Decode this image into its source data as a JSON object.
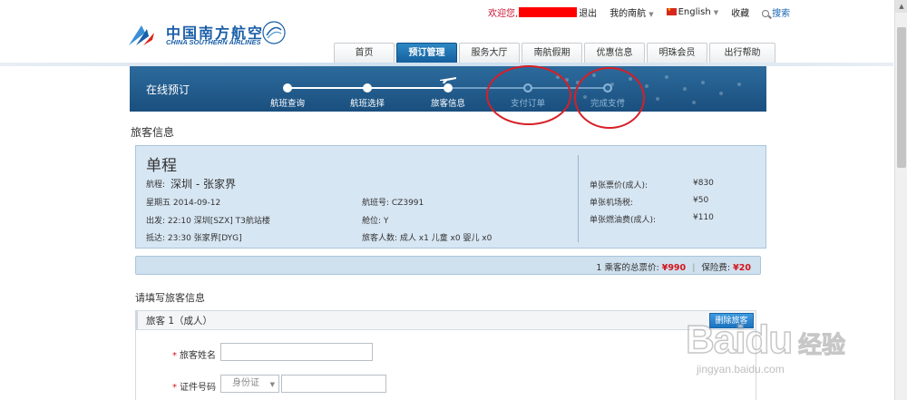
{
  "topbar": {
    "welcome": "欢迎您,",
    "logout": "退出",
    "my_account": "我的南航",
    "language": "English",
    "favorite": "收藏",
    "search": "搜索"
  },
  "logo": {
    "cn": "中国南方航空",
    "en": "CHINA SOUTHERN AIRLINES",
    "brand_color": "#1a5fa8"
  },
  "nav": {
    "tabs": [
      {
        "label": "首页",
        "active": false
      },
      {
        "label": "预订管理",
        "active": true
      },
      {
        "label": "服务大厅",
        "active": false
      },
      {
        "label": "南航假期",
        "active": false
      },
      {
        "label": "优惠信息",
        "active": false
      },
      {
        "label": "明珠会员",
        "active": false
      },
      {
        "label": "出行帮助",
        "active": false
      }
    ]
  },
  "progress": {
    "title": "在线预订",
    "steps": [
      {
        "label": "航班查询",
        "done": true
      },
      {
        "label": "航班选择",
        "done": true
      },
      {
        "label": "旅客信息",
        "done": true,
        "current": true
      },
      {
        "label": "支付订单",
        "done": false
      },
      {
        "label": "完成支付",
        "done": false
      }
    ]
  },
  "section": {
    "title": "旅客信息"
  },
  "itinerary": {
    "trip_type": "单程",
    "route_label": "航程:",
    "route": "深圳 - 张家界",
    "date": "星期五 2014-09-12",
    "depart": "出发:  22:10 深圳[SZX] T3航站楼",
    "arrive": "抵达:  23:30 张家界[DYG]",
    "flight_no": "航班号:  CZ3991",
    "cabin": "舱位:  Y",
    "pax_count": "旅客人数:  成人  x1    儿童  x0    婴儿  x0",
    "fares": [
      {
        "label": "单张票价(成人):",
        "value": "¥830"
      },
      {
        "label": "单张机场税:",
        "value": "¥50"
      },
      {
        "label": "单张燃油费(成人):",
        "value": "¥110"
      }
    ]
  },
  "totals": {
    "prefix": "1  乘客的总票价:",
    "total": "¥990",
    "insurance_label": "保险费:",
    "insurance": "¥20"
  },
  "form": {
    "title": "请填写旅客信息",
    "passenger_header": "旅客 1（成人）",
    "delete_button": "删除旅客",
    "fields": {
      "name_label": "旅客姓名",
      "name_value": "",
      "id_label": "证件号码",
      "id_type": "身份证",
      "id_value": ""
    }
  },
  "watermark": {
    "brand": "Baidu",
    "cn": "经验",
    "url": "jingyan.baidu.com"
  }
}
